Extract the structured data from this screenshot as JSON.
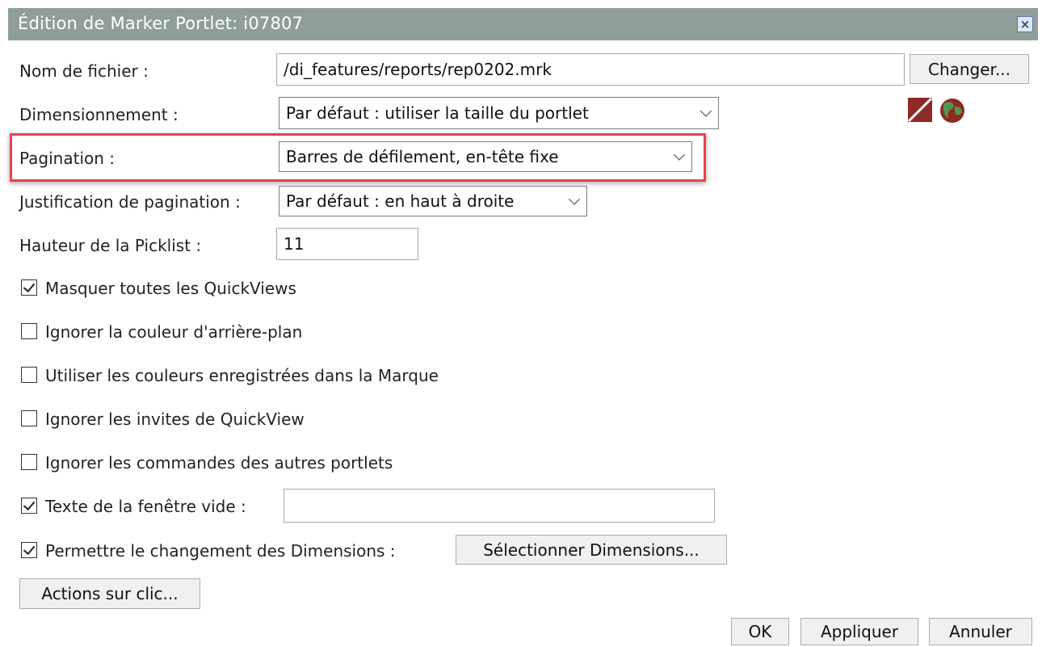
{
  "window": {
    "title": "Édition de Marker Portlet: i07807",
    "close_glyph": "×"
  },
  "form": {
    "filename": {
      "label": "Nom de fichier :",
      "value": "/di_features/reports/rep0202.mrk",
      "button": "Changer..."
    },
    "sizing": {
      "label": "Dimensionnement :",
      "value": "Par défaut : utiliser la taille du portlet"
    },
    "pagination": {
      "label": "Pagination :",
      "value": "Barres de défilement, en-tête fixe"
    },
    "pagination_justification": {
      "label": "Justification de pagination :",
      "value": "Par défaut : en haut à droite"
    },
    "picklist_height": {
      "label": "Hauteur de la Picklist :",
      "value": "11"
    },
    "checkboxes": [
      {
        "label": "Masquer toutes les QuickViews",
        "checked": true
      },
      {
        "label": "Ignorer la couleur d'arrière-plan",
        "checked": false
      },
      {
        "label": "Utiliser les couleurs enregistrées dans la Marque",
        "checked": false
      },
      {
        "label": "Ignorer les invites de QuickView",
        "checked": false
      },
      {
        "label": "Ignorer les commandes des autres portlets",
        "checked": false
      }
    ],
    "empty_window_text": {
      "label": "Texte de la fenêtre vide :",
      "checked": true,
      "value": ""
    },
    "allow_dimension_change": {
      "label": "Permettre le changement des Dimensions :",
      "checked": true,
      "button": "Sélectionner Dimensions..."
    },
    "click_actions_button": "Actions sur clic..."
  },
  "footer": {
    "ok": "OK",
    "apply": "Appliquer",
    "cancel": "Annuler"
  },
  "icons": [
    "edit-slash-icon",
    "globe-icon"
  ],
  "colors": {
    "titlebar": "#8f9e99",
    "highlight": "#e8434b"
  }
}
